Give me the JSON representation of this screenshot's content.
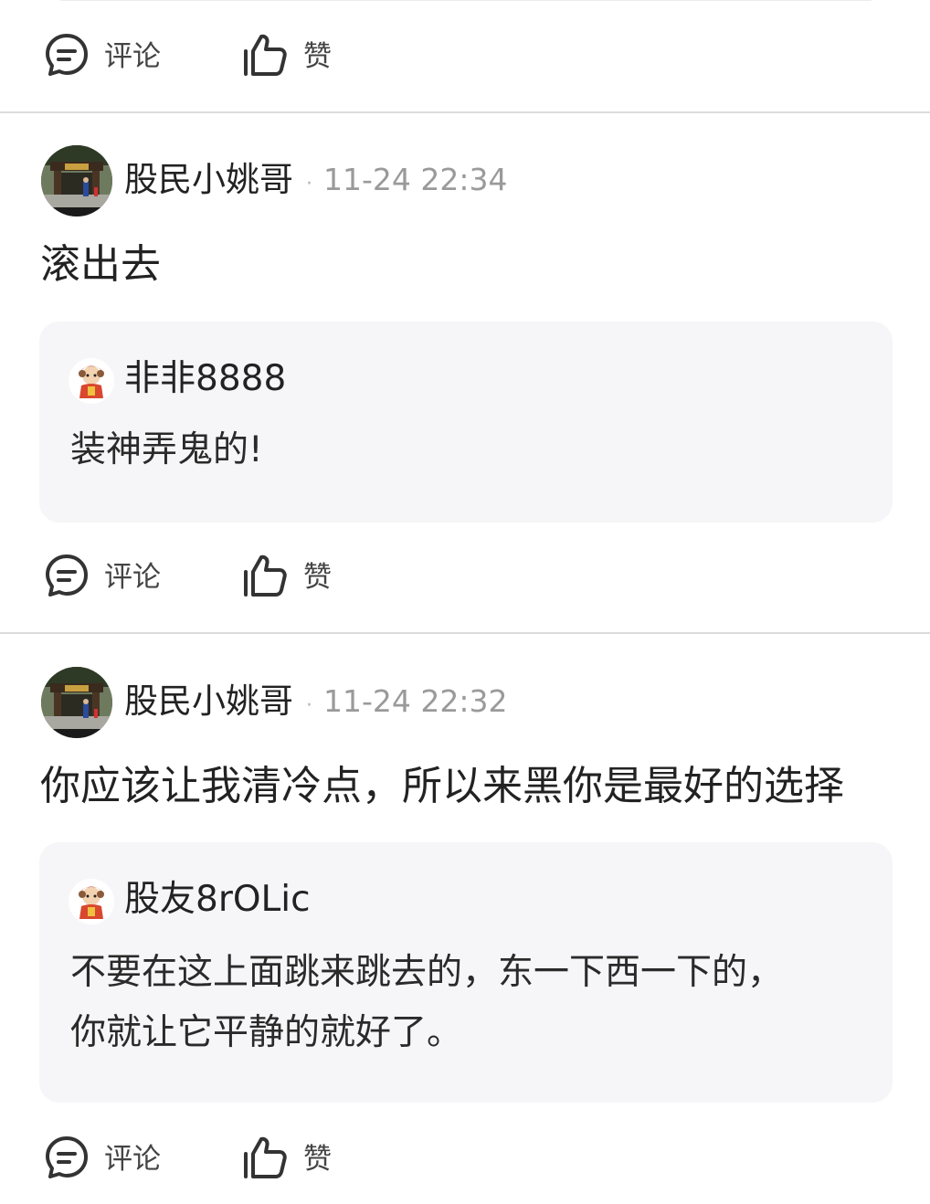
{
  "actions": {
    "comment_label": "评论",
    "like_label": "赞"
  },
  "comments": [
    {
      "author": "股民小姚哥",
      "time": "11-24 22:34",
      "text": "滚出去",
      "quote": {
        "name": "非非8888",
        "lines": [
          "装神弄鬼的!"
        ]
      }
    },
    {
      "author": "股民小姚哥",
      "time": "11-24 22:32",
      "text": "你应该让我清冷点，所以来黑你是最好的选择",
      "quote": {
        "name": "股友8rOLic",
        "lines": [
          "不要在这上面跳来跳去的，东一下西一下的，",
          "你就让它平静的就好了。"
        ]
      }
    }
  ],
  "icons": {
    "comment": "comment-bubble-icon",
    "like": "thumbs-up-icon"
  },
  "colors": {
    "divider": "#dcdcdc",
    "quote_bg": "#f6f6f8",
    "meta_text": "#9a9a9a"
  }
}
